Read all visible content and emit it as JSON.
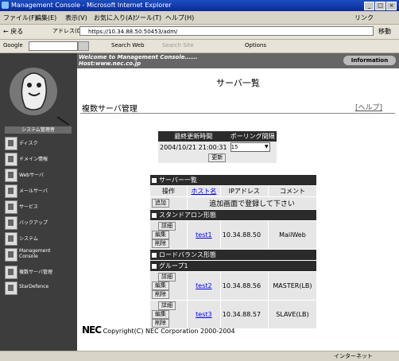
{
  "window": {
    "title": "Management Console - Microsoft Internet Explorer"
  },
  "menubar": [
    "ファイル(F)",
    "編集(E)",
    "表示(V)",
    "お気に入り(A)",
    "ツール(T)",
    "ヘルプ(H)"
  ],
  "menubar_right": "リンク",
  "toolbar": {
    "back": "← 戻る",
    "address_label": "アドレス(D)",
    "address": "https://10.34.88.50:50453/adm/",
    "go": "移動"
  },
  "linkbar": {
    "google": "Google",
    "search_web": "Search Web",
    "search_site": "Search Site",
    "options": "Options"
  },
  "sidebar": {
    "system_title": "システム管理者",
    "items": [
      {
        "label": "ディスク"
      },
      {
        "label": "ドメイン情報"
      },
      {
        "label": "Webサーバ"
      },
      {
        "label": "メールサーバ"
      },
      {
        "label": "サービス"
      },
      {
        "label": "バックアップ"
      },
      {
        "label": "システム"
      },
      {
        "label": "Management Console"
      },
      {
        "label": "複数サーバ管理"
      },
      {
        "label": "StarDefence"
      }
    ]
  },
  "banner": {
    "line1": "Welcome to Management Console......",
    "line2": "Host:www.nec.co.jp",
    "info": "Information"
  },
  "main": {
    "page_title": "サーバ一覧",
    "subheader": "複数サーバ管理",
    "help": "[ヘルプ]",
    "poll": {
      "h1": "最終更新時間",
      "h2": "ポーリング間隔",
      "time": "2004/10/21 21:00:31",
      "interval": "15",
      "update": "更新"
    },
    "servers": {
      "title": "サーバー一覧",
      "cols": [
        "操作",
        "ホスト名",
        "IPアドレス",
        "コメント"
      ],
      "add": "追加",
      "add_msg": "追加画面で登録して下さい",
      "standalone": "スタンドアロン形態",
      "loadbalance": "ロードバランス形態",
      "group": "グループ1",
      "detail": "詳細",
      "edit": "編集",
      "delete": "削除",
      "rows": [
        {
          "host": "test1",
          "ip": "10.34.88.50",
          "comment": "MailWeb"
        },
        {
          "host": "test2",
          "ip": "10.34.88.56",
          "comment": "MASTER(LB)"
        },
        {
          "host": "test3",
          "ip": "10.34.88.57",
          "comment": "SLAVE(LB)"
        }
      ]
    },
    "footer": {
      "brand": "NEC",
      "copy": "Copyright(C) NEC Corporation 2000-2004"
    }
  },
  "status": {
    "zone": "インターネット"
  }
}
